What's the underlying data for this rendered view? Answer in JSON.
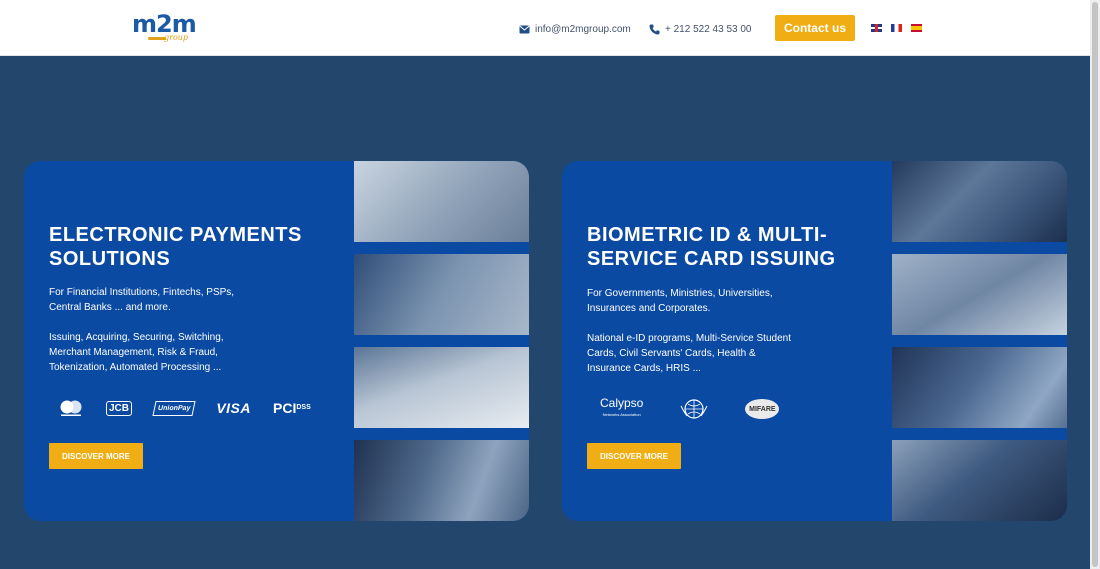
{
  "header": {
    "logo_text": "m2m",
    "logo_sub": "group",
    "email": "info@m2mgroup.com",
    "phone": "+ 212 522 43 53 00",
    "contact_label": "Contact us",
    "languages": [
      "en-flag-icon",
      "fr-flag-icon",
      "es-flag-icon"
    ]
  },
  "cards": [
    {
      "title": "ELECTRONIC PAYMENTS SOLUTIONS",
      "sub1": "For Financial Institutions, Fintechs, PSPs, Central Banks ... and more.",
      "sub2": "Issuing, Acquiring, Securing, Switching, Merchant Management, Risk & Fraud, Tokenization, Automated Processing ...",
      "logos": [
        "mastercard-icon",
        "JCB",
        "UnionPay",
        "VISA",
        "PCI",
        "DSS"
      ],
      "button": "DISCOVER MORE"
    },
    {
      "title": "BIOMETRIC ID & MULTI-SERVICE CARD ISSUING",
      "sub1": "For Governments, Ministries, Universities, Insurances and Corporates.",
      "sub2": "National e-ID programs, Multi-Service Student Cards, Civil Servants' Cards, Health & Insurance Cards, HRIS ...",
      "logos": [
        "Calypso",
        "Networks Association",
        "icao-icon",
        "MIFARE"
      ],
      "button": "DISCOVER MORE"
    }
  ],
  "colors": {
    "accent": "#f0ae14",
    "card_blue": "#0b4aa3",
    "page_bg": "#23466c"
  }
}
